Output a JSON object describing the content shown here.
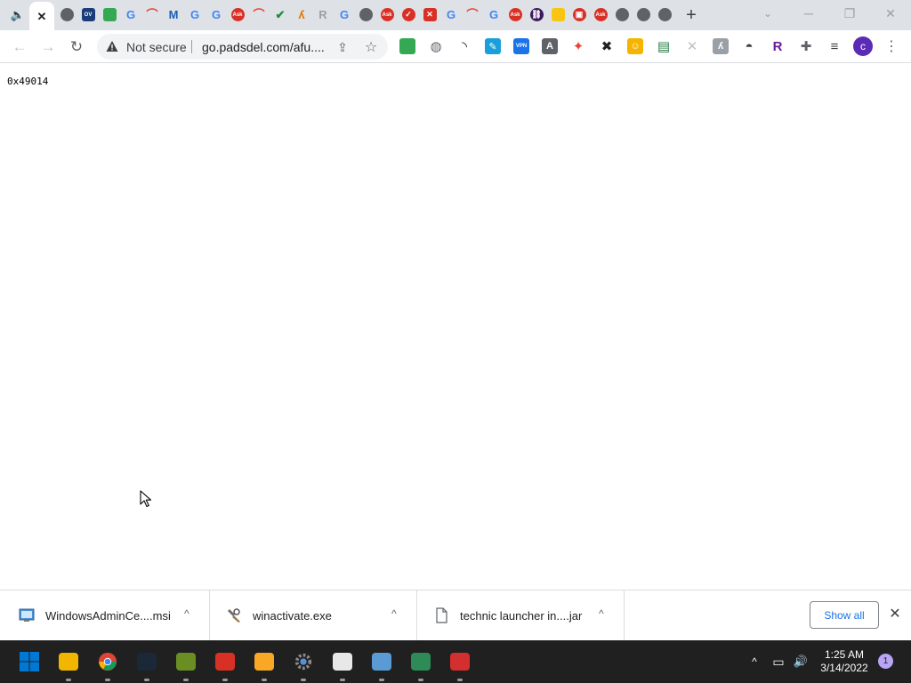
{
  "browser": {
    "tabs": [
      {
        "name": "audio-icon",
        "glyph": "🔈",
        "color": "#5f6368",
        "shape": "txt"
      },
      {
        "name": "tab-close-icon",
        "glyph": "✕",
        "color": "#202124",
        "shape": "txt",
        "active": true
      },
      {
        "name": "globe-favicon-icon",
        "glyph": "",
        "color": "#5f6368"
      },
      {
        "name": "ov-favicon-icon",
        "glyph": "OV",
        "color": "#1a3c7a",
        "shape": "sq"
      },
      {
        "name": "messages-favicon-icon",
        "glyph": "",
        "color": "#34a853",
        "shape": "sq"
      },
      {
        "name": "google-favicon-icon",
        "glyph": "G",
        "color": "#4285f4",
        "shape": "txt"
      },
      {
        "name": "rainbow-favicon-icon",
        "glyph": "⌒",
        "color": "#ea4335",
        "shape": "txt"
      },
      {
        "name": "malwarebytes-favicon-icon",
        "glyph": "M",
        "color": "#1a5fb4",
        "shape": "txt"
      },
      {
        "name": "google-favicon-icon",
        "glyph": "G",
        "color": "#4285f4",
        "shape": "txt"
      },
      {
        "name": "google-favicon-icon",
        "glyph": "G",
        "color": "#4285f4",
        "shape": "txt"
      },
      {
        "name": "ask-favicon-icon",
        "glyph": "Ask",
        "color": "#d93025"
      },
      {
        "name": "rainbow-favicon-icon",
        "glyph": "⌒",
        "color": "#ea4335",
        "shape": "txt"
      },
      {
        "name": "check-favicon-icon",
        "glyph": "✔",
        "color": "#1e8e3e",
        "shape": "txt"
      },
      {
        "name": "runner-favicon-icon",
        "glyph": "ʎ",
        "color": "#e37400",
        "shape": "txt"
      },
      {
        "name": "r-favicon-icon",
        "glyph": "R",
        "color": "#9aa0a6",
        "shape": "txt"
      },
      {
        "name": "google-favicon-icon",
        "glyph": "G",
        "color": "#4285f4",
        "shape": "txt"
      },
      {
        "name": "globe-favicon-icon",
        "glyph": "",
        "color": "#5f6368"
      },
      {
        "name": "ask-favicon-icon",
        "glyph": "Ask",
        "color": "#d93025"
      },
      {
        "name": "check-circle-favicon-icon",
        "glyph": "✓",
        "color": "#d93025"
      },
      {
        "name": "shield-favicon-icon",
        "glyph": "✕",
        "color": "#d93025",
        "shape": "sq"
      },
      {
        "name": "google-favicon-icon",
        "glyph": "G",
        "color": "#4285f4",
        "shape": "txt"
      },
      {
        "name": "rainbow-favicon-icon",
        "glyph": "⌒",
        "color": "#ea4335",
        "shape": "txt"
      },
      {
        "name": "google-favicon-icon",
        "glyph": "G",
        "color": "#4285f4",
        "shape": "txt"
      },
      {
        "name": "ask-favicon-icon",
        "glyph": "Ask",
        "color": "#d93025"
      },
      {
        "name": "link-favicon-icon",
        "glyph": "⛓",
        "color": "#3c1a5b"
      },
      {
        "name": "folder-favicon-icon",
        "glyph": "",
        "color": "#f9c513",
        "shape": "sq"
      },
      {
        "name": "gift-favicon-icon",
        "glyph": "▣",
        "color": "#d93025"
      },
      {
        "name": "ask-favicon-icon",
        "glyph": "Ask",
        "color": "#d93025"
      },
      {
        "name": "globe-favicon-icon",
        "glyph": "",
        "color": "#5f6368"
      },
      {
        "name": "globe-favicon-icon",
        "glyph": "",
        "color": "#5f6368"
      },
      {
        "name": "globe-favicon-icon",
        "glyph": "",
        "color": "#5f6368"
      }
    ],
    "new_tab_glyph": "+",
    "tab_search_glyph": "⌄",
    "minimize_glyph": "─",
    "restore_glyph": "❐",
    "close_glyph": "✕",
    "back_glyph": "←",
    "forward_glyph": "→",
    "reload_glyph": "↻",
    "security_label": "Not secure",
    "url": "go.padsdel.com/afu....",
    "share_glyph": "⇪",
    "bookmark_glyph": "☆",
    "extensions": [
      {
        "name": "green-ext-icon",
        "glyph": "",
        "color": "#34a853"
      },
      {
        "name": "fingerprint-ext-icon",
        "glyph": "◍",
        "color": "#5f6368",
        "text": true
      },
      {
        "name": "rss-ext-icon",
        "glyph": "◝",
        "color": "#202124",
        "text": true
      },
      {
        "name": "edit-ext-icon",
        "glyph": "✎",
        "color": "#1a9fdb"
      },
      {
        "name": "vpn-ext-icon",
        "glyph": "VPN",
        "color": "#1a73e8"
      },
      {
        "name": "font-ext-icon",
        "glyph": "A",
        "color": "#5f6368"
      },
      {
        "name": "color-picker-ext-icon",
        "glyph": "✦",
        "color": "#ea4335",
        "text": true
      },
      {
        "name": "tools-ext-icon",
        "glyph": "✖",
        "color": "#202124",
        "text": true
      },
      {
        "name": "emoji-ext-icon",
        "glyph": "☺",
        "color": "#f4b400"
      },
      {
        "name": "terminal-ext-icon",
        "glyph": "▤",
        "color": "#1e7a3e",
        "text": true
      },
      {
        "name": "cross-ext-icon",
        "glyph": "✕",
        "color": "#bdc1c6",
        "text": true
      },
      {
        "name": "runner-ext-icon",
        "glyph": "ʎ",
        "color": "#9aa0a6"
      },
      {
        "name": "hat-ext-icon",
        "glyph": "◓",
        "color": "#3c4043",
        "text": true
      },
      {
        "name": "r-ext-icon",
        "glyph": "R",
        "color": "#6a1b9a",
        "text": true
      },
      {
        "name": "puzzle-ext-icon",
        "glyph": "✚",
        "color": "#5f6368",
        "text": true
      },
      {
        "name": "playlist-ext-icon",
        "glyph": "≡",
        "color": "#3c4043",
        "text": true
      }
    ],
    "profile_initial": "c",
    "menu_glyph": "⋮"
  },
  "page": {
    "text": "0x49014"
  },
  "downloads": {
    "items": [
      {
        "name": "WindowsAdminCe....msi",
        "icon": "installer"
      },
      {
        "name": "winactivate.exe",
        "icon": "tool"
      },
      {
        "name": "technic launcher in....jar",
        "icon": "file"
      }
    ],
    "chevron_glyph": "^",
    "show_all_label": "Show all",
    "close_glyph": "✕"
  },
  "taskbar": {
    "apps": [
      {
        "name": "start-button-icon",
        "color": "#0078d4"
      },
      {
        "name": "file-explorer-icon",
        "color": "#f2b600"
      },
      {
        "name": "chrome-icon",
        "color": "#34a853"
      },
      {
        "name": "steam-icon",
        "color": "#1b2838"
      },
      {
        "name": "minecraft-icon",
        "color": "#6b8e23"
      },
      {
        "name": "vpn-shield-icon",
        "color": "#d93025"
      },
      {
        "name": "norton-shield-icon",
        "color": "#f9a825"
      },
      {
        "name": "settings-gear-icon",
        "color": "#8a8a8a"
      },
      {
        "name": "files-app-icon",
        "color": "#e8e8e8"
      },
      {
        "name": "photos-app-icon",
        "color": "#5b9bd5"
      },
      {
        "name": "notepad-app-icon",
        "color": "#2e8b57"
      },
      {
        "name": "car-game-icon",
        "color": "#d32f2f"
      }
    ],
    "tray_chevron_glyph": "^",
    "network_glyph": "▭",
    "volume_glyph": "🔊",
    "time": "1:25 AM",
    "date": "3/14/2022",
    "notification_count": "1"
  }
}
